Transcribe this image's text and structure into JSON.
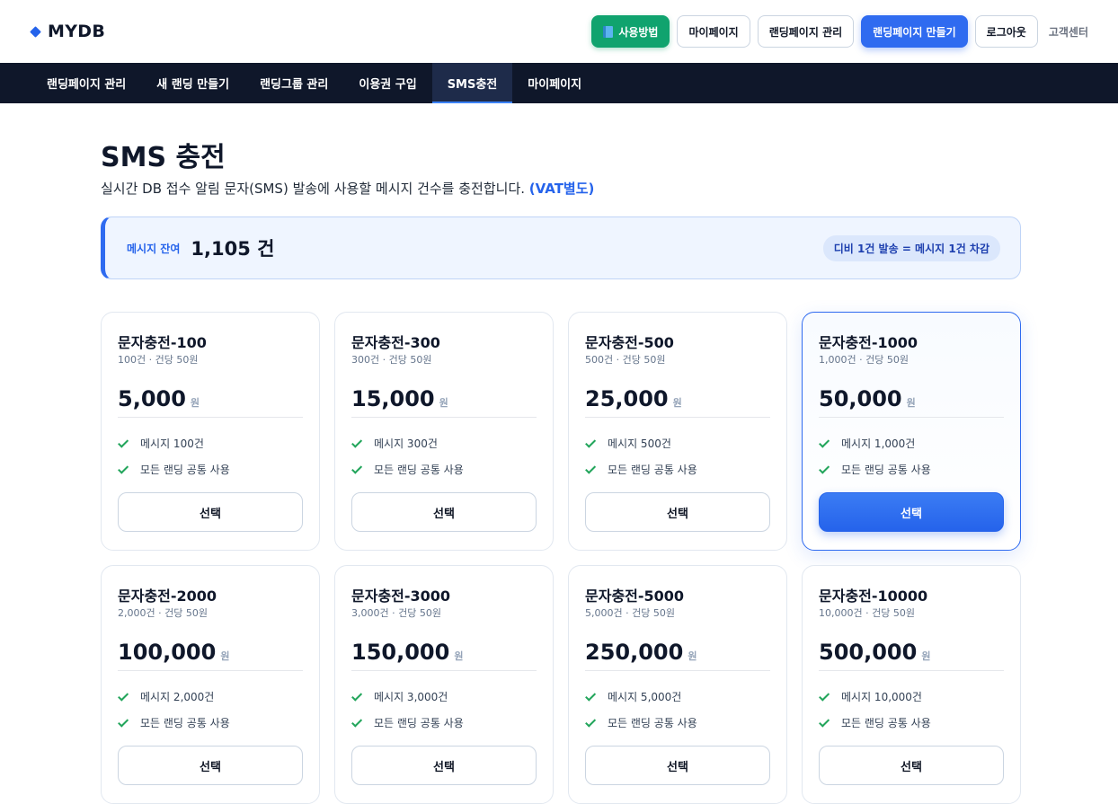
{
  "header": {
    "brand": "MYDB",
    "buttons": {
      "guide": "사용방법",
      "mypage": "마이페이지",
      "manage_landing": "랜딩페이지 관리",
      "create_landing": "랜딩페이지 만들기",
      "logout": "로그아웃"
    },
    "help": "고객센터"
  },
  "nav": {
    "items": [
      {
        "label": "랜딩페이지 관리"
      },
      {
        "label": "새 랜딩 만들기"
      },
      {
        "label": "랜딩그룹 관리"
      },
      {
        "label": "이용권 구입"
      },
      {
        "label": "SMS충전"
      },
      {
        "label": "마이페이지"
      }
    ],
    "active": "SMS충전"
  },
  "page": {
    "title": "SMS 충전",
    "description": "실시간 DB 접수 알림 문자(SMS) 발송에 사용할 메시지 건수를 충전합니다.",
    "vat_note": "(VAT별도)"
  },
  "balance": {
    "label": "메시지 잔여",
    "value": "1,105 건",
    "note": "디비 1건 발송 = 메시지 1건 차감"
  },
  "plans": [
    {
      "name": "문자충전-100",
      "sub": "100건 · 건당 50원",
      "price": "5,000",
      "unit": "원",
      "features": [
        "메시지 100건",
        "모든 랜딩 공통 사용"
      ],
      "button": "선택"
    },
    {
      "name": "문자충전-300",
      "sub": "300건 · 건당 50원",
      "price": "15,000",
      "unit": "원",
      "features": [
        "메시지 300건",
        "모든 랜딩 공통 사용"
      ],
      "button": "선택"
    },
    {
      "name": "문자충전-500",
      "sub": "500건 · 건당 50원",
      "price": "25,000",
      "unit": "원",
      "features": [
        "메시지 500건",
        "모든 랜딩 공통 사용"
      ],
      "button": "선택"
    },
    {
      "name": "문자충전-1000",
      "sub": "1,000건 · 건당 50원",
      "price": "50,000",
      "unit": "원",
      "features": [
        "메시지 1,000건",
        "모든 랜딩 공통 사용"
      ],
      "button": "선택"
    },
    {
      "name": "문자충전-2000",
      "sub": "2,000건 · 건당 50원",
      "price": "100,000",
      "unit": "원",
      "features": [
        "메시지 2,000건",
        "모든 랜딩 공통 사용"
      ],
      "button": "선택"
    },
    {
      "name": "문자충전-3000",
      "sub": "3,000건 · 건당 50원",
      "price": "150,000",
      "unit": "원",
      "features": [
        "메시지 3,000건",
        "모든 랜딩 공통 사용"
      ],
      "button": "선택"
    },
    {
      "name": "문자충전-5000",
      "sub": "5,000건 · 건당 50원",
      "price": "250,000",
      "unit": "원",
      "features": [
        "메시지 5,000건",
        "모든 랜딩 공통 사용"
      ],
      "button": "선택"
    },
    {
      "name": "문자충전-10000",
      "sub": "10,000건 · 건당 50원",
      "price": "500,000",
      "unit": "원",
      "features": [
        "메시지 10,000건",
        "모든 랜딩 공통 사용"
      ],
      "button": "선택"
    }
  ],
  "featured_plan": "문자충전-1000",
  "colors": {
    "accent": "#2f6bf0",
    "guide_button": "#10a36e",
    "nav_bg": "#0f172a",
    "check": "#22a55b"
  }
}
